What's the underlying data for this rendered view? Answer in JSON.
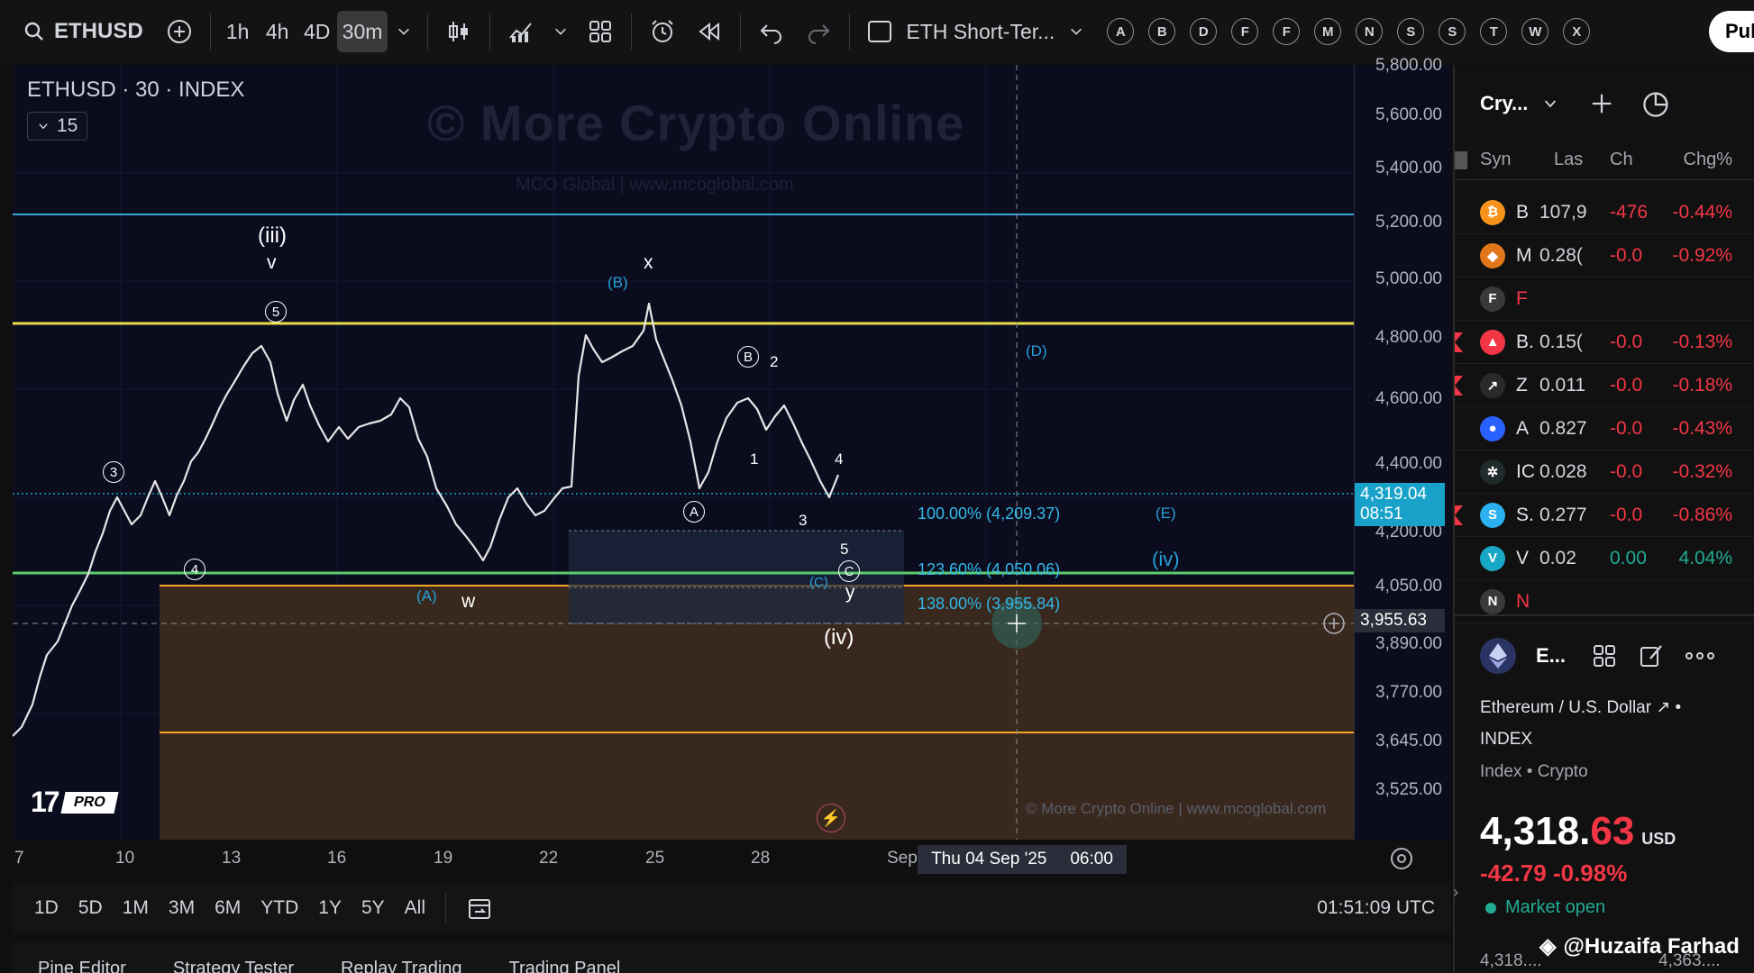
{
  "toolbar": {
    "symbol": "ETHUSD",
    "intervals": [
      "1h",
      "4h",
      "4D",
      "30m"
    ],
    "active_interval": "30m",
    "layout_name": "ETH Short-Ter...",
    "quick_letters": [
      "A",
      "B",
      "D",
      "F",
      "F",
      "M",
      "N",
      "S",
      "S",
      "T",
      "W",
      "X"
    ],
    "publish_label": "Pub"
  },
  "chart": {
    "legend_title": "ETHUSD · 30 · INDEX",
    "legend_count": "15",
    "watermark_title": "© More Crypto Online",
    "watermark_sub": "MCO Global  |  www.mcoglobal.com",
    "copyright": "© More Crypto Online  |  www.mcoglobal.com",
    "tv_pro_label": "PRO",
    "wave_labels": {
      "iii": "(iii)",
      "v": "v",
      "five": "5",
      "three": "3",
      "four": "4",
      "A_cyan": "(A)",
      "w": "w",
      "B_cyan": "(B)",
      "x": "x",
      "B_circ": "B",
      "two": "2",
      "one": "1",
      "four_b": "4",
      "A_circ": "A",
      "three_b": "3",
      "five_b": "5",
      "C_circ": "C",
      "C_cyan": "(C)",
      "y": "y",
      "iv": "(iv)",
      "D_cyan": "(D)",
      "E_cyan": "(E)",
      "iv_cyan": "(iv)"
    },
    "fib_levels": [
      {
        "label": "100.00% (4,209.37)",
        "price": 4209.37
      },
      {
        "label": "123.60% (4,050.06)",
        "price": 4050.06
      },
      {
        "label": "138.00% (3,955.84)",
        "price": 3955.84
      }
    ]
  },
  "price_axis": {
    "labels": [
      "5,800.00",
      "5,600.00",
      "5,400.00",
      "5,200.00",
      "5,000.00",
      "4,800.00",
      "4,600.00",
      "4,400.00",
      "4,200.00",
      "4,050.00",
      "3,890.00",
      "3,770.00",
      "3,645.00",
      "3,525.00"
    ],
    "current_price": "4,319.04",
    "countdown": "08:51",
    "crosshair_price": "3,955.63"
  },
  "time_axis": {
    "labels": [
      "7",
      "10",
      "13",
      "16",
      "19",
      "22",
      "25",
      "28",
      "Sep"
    ],
    "crosshair_date": "Thu 04 Sep '25",
    "crosshair_time": "06:00"
  },
  "range_bar": {
    "ranges": [
      "1D",
      "5D",
      "1M",
      "3M",
      "6M",
      "YTD",
      "1Y",
      "5Y",
      "All"
    ],
    "clock": "01:51:09 UTC"
  },
  "bottom_tabs": [
    "Pine Editor",
    "Strategy Tester",
    "Replay Trading",
    "Trading Panel"
  ],
  "watchlist": {
    "title": "Cry...",
    "columns": {
      "symbol": "Syn",
      "last": "Las",
      "change": "Ch",
      "change_pct": "Chg%"
    },
    "rows": [
      {
        "sym": "B",
        "last": "107,9",
        "ch": "-476",
        "pct": "-0.44%",
        "color": "#f7931a",
        "glyph": "₿",
        "flag": false,
        "dir": "neg"
      },
      {
        "sym": "M",
        "last": "0.28(",
        "ch": "-0.0",
        "pct": "-0.92%",
        "color": "#e2761b",
        "glyph": "◆",
        "flag": false,
        "dir": "neg"
      },
      {
        "sym": "F",
        "last": "",
        "ch": "",
        "pct": "",
        "color": "#3a3a3a",
        "glyph": "F",
        "flag": false,
        "dir": "neg"
      },
      {
        "sym": "B.",
        "last": "0.15(",
        "ch": "-0.0",
        "pct": "-0.13%",
        "color": "#f23645",
        "glyph": "▲",
        "flag": true,
        "dir": "neg"
      },
      {
        "sym": "Z",
        "last": "0.011",
        "ch": "-0.0",
        "pct": "-0.18%",
        "color": "#2a2a2a",
        "glyph": "↗",
        "flag": true,
        "dir": "neg"
      },
      {
        "sym": "A",
        "last": "0.827",
        "ch": "-0.0",
        "pct": "-0.43%",
        "color": "#2962ff",
        "glyph": "●",
        "flag": false,
        "dir": "neg"
      },
      {
        "sym": "IC",
        "last": "0.028",
        "ch": "-0.0",
        "pct": "-0.32%",
        "color": "#1f2a2a",
        "glyph": "✲",
        "flag": false,
        "dir": "neg"
      },
      {
        "sym": "S.",
        "last": "0.277",
        "ch": "-0.0",
        "pct": "-0.86%",
        "color": "#2bb1f0",
        "glyph": "S",
        "flag": true,
        "dir": "neg"
      },
      {
        "sym": "V",
        "last": "0.02",
        "ch": "0.00",
        "pct": "4.04%",
        "color": "#18a8c6",
        "glyph": "V",
        "flag": false,
        "dir": "pos"
      },
      {
        "sym": "N",
        "last": "",
        "ch": "",
        "pct": "",
        "color": "#3a3a3a",
        "glyph": "N",
        "flag": false,
        "dir": "neg"
      }
    ]
  },
  "details": {
    "short_name": "E...",
    "full_name": "Ethereum / U.S. Dollar",
    "exchange": "INDEX",
    "category": "Index • Crypto",
    "price_int": "4,318.",
    "price_dec": "63",
    "currency": "USD",
    "change": "-42.79  -0.98%",
    "status": "Market open",
    "bottom_left": "4,318....",
    "bottom_right": "4,363...."
  },
  "credit": "@Huzaifa Farhad",
  "colors": {
    "cyan_line": "#3aa6d8",
    "yellow_line": "#e8e04a",
    "green_line": "#5ecc6e",
    "orange_line": "#f5a623",
    "candle": "#e6e6e6",
    "current_price": "#18a2c9"
  }
}
